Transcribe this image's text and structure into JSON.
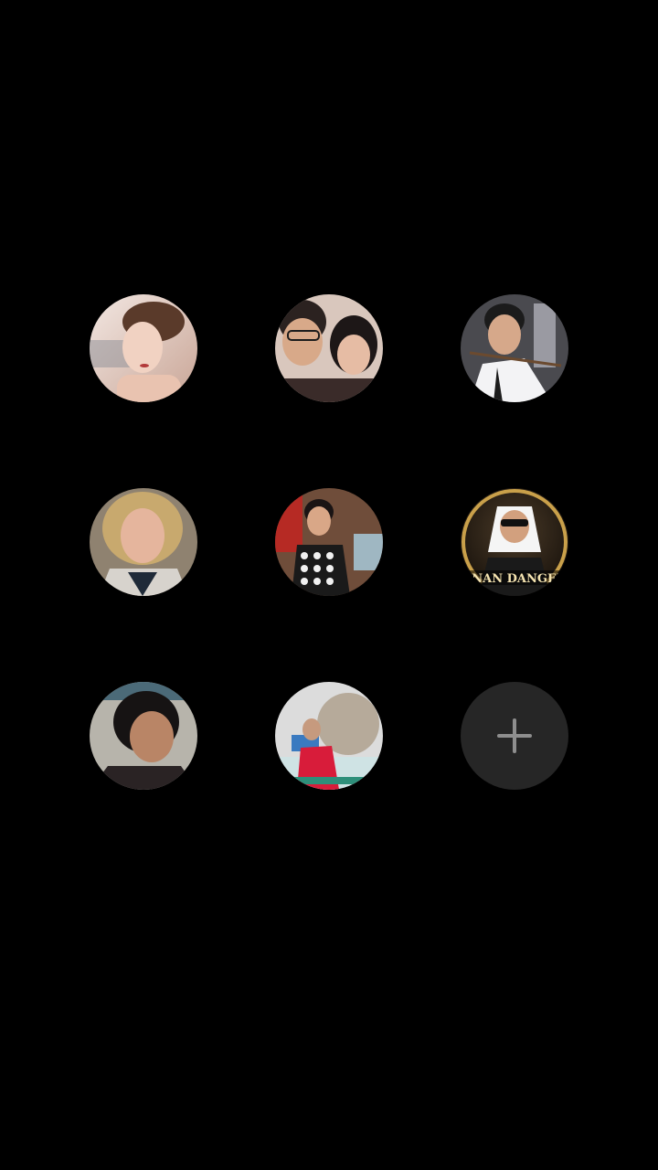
{
  "screen": {
    "background": "#000000"
  },
  "contacts": [
    {
      "id": "contact-1",
      "icon": "avatar-photo"
    },
    {
      "id": "contact-2",
      "icon": "avatar-photo"
    },
    {
      "id": "contact-3",
      "icon": "avatar-photo"
    },
    {
      "id": "contact-4",
      "icon": "avatar-photo"
    },
    {
      "id": "contact-5",
      "icon": "avatar-photo"
    },
    {
      "id": "contact-6",
      "icon": "avatar-photo",
      "logo_text": "ENAN DANGER"
    },
    {
      "id": "contact-7",
      "icon": "avatar-photo"
    },
    {
      "id": "contact-8",
      "icon": "avatar-photo"
    }
  ],
  "add_button": {
    "icon": "plus-icon",
    "background": "#262626",
    "icon_color": "#8e8e8e"
  }
}
